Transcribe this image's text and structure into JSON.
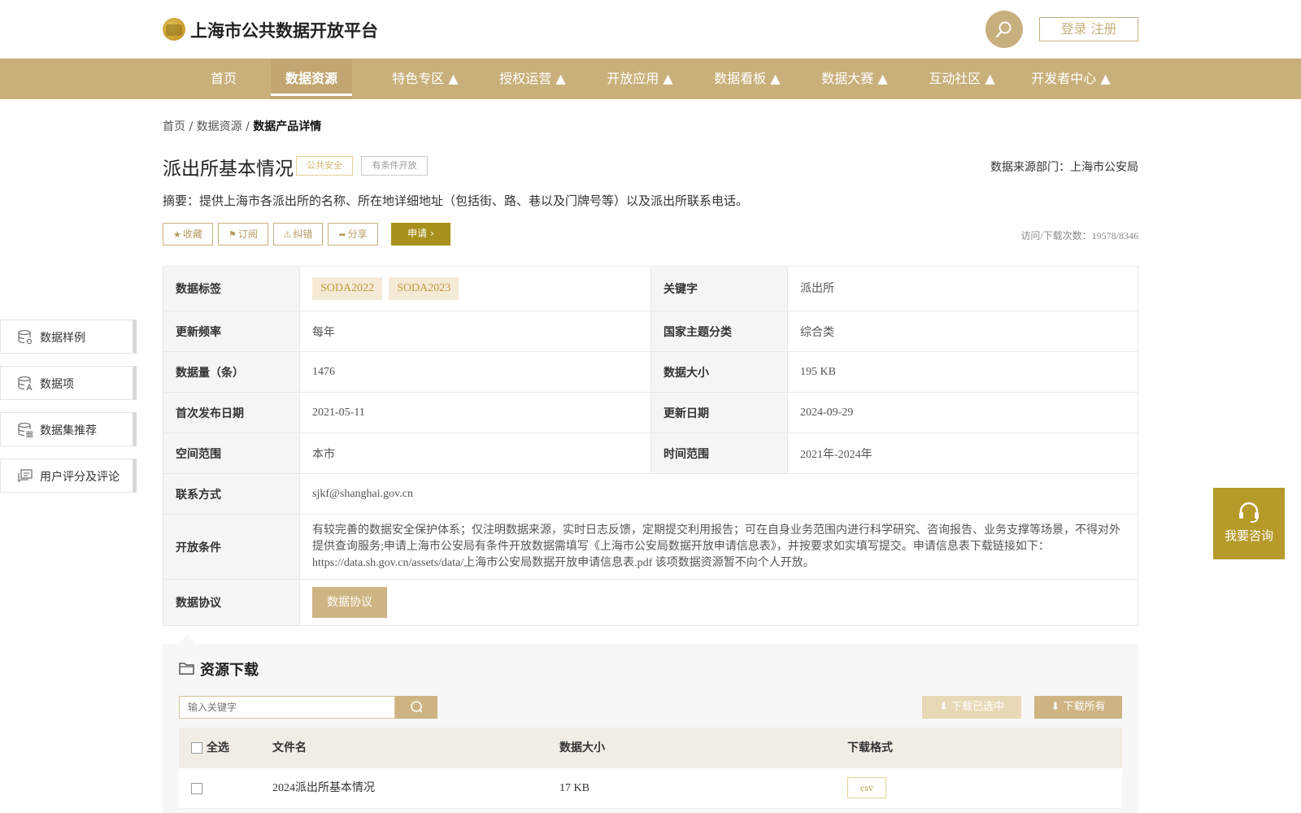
{
  "header": {
    "site_title": "上海市公共数据开放平台",
    "login_label": "登录 注册",
    "icons": {
      "logo": "brand-logo",
      "search": "search-icon"
    }
  },
  "nav": {
    "items": [
      {
        "label": "首页",
        "active": false
      },
      {
        "label": "数据资源",
        "active": true
      },
      {
        "label": "特色专区 ▲",
        "active": false
      },
      {
        "label": "授权运营 ▲",
        "active": false
      },
      {
        "label": "开放应用 ▲",
        "active": false
      },
      {
        "label": "数据看板 ▲",
        "active": false
      },
      {
        "label": "数据大赛 ▲",
        "active": false
      },
      {
        "label": "互动社区 ▲",
        "active": false
      },
      {
        "label": "开发者中心 ▲",
        "active": false
      }
    ]
  },
  "breadcrumb": {
    "home": "首页",
    "sep": "/",
    "section": "数据资源",
    "current": "数据产品详情"
  },
  "product": {
    "title": "派出所基本情况",
    "tag_category": "公共安全",
    "tag_open": "有条件开放",
    "source": "数据来源部门：上海市公安局",
    "summary": "摘要：提供上海市各派出所的名称、所在地详细地址（包括街、路、巷以及门牌号等）以及派出所联系电话。"
  },
  "actions": {
    "favorite": "收藏",
    "subscribe": "订阅",
    "report": "纠错",
    "share": "分享",
    "apply": "申请",
    "visits": "访问/下载次数：19578/8346"
  },
  "info": {
    "tags_label": "数据标签",
    "tags": [
      "SODA2022",
      "SODA2023"
    ],
    "keyword_label": "关键字",
    "keyword": "派出所",
    "freq_label": "更新频率",
    "freq": "每年",
    "theme_label": "国家主题分类",
    "theme": "综合类",
    "count_label": "数据量（条）",
    "count": "1476",
    "size_label": "数据大小",
    "size": "195 KB",
    "first_label": "首次发布日期",
    "first": "2021-05-11",
    "updated_label": "更新日期",
    "updated": "2024-09-29",
    "space_label": "空间范围",
    "space": "本市",
    "time_label": "时间范围",
    "time": "2021年-2024年",
    "contact_label": "联系方式",
    "contact": "sjkf@shanghai.gov.cn",
    "cond_label": "开放条件",
    "cond": "有较完善的数据安全保护体系；仅注明数据来源，实时日志反馈，定期提交利用报告；可在自身业务范围内进行科学研究、咨询报告、业务支撑等场景，不得对外提供查询服务;申请上海市公安局有条件开放数据需填写《上海市公安局数据开放申请信息表》，并按要求如实填写提交。申请信息表下载链接如下：https://data.sh.gov.cn/assets/data/上海市公安局数据开放申请信息表.pdf 该项数据资源暂不向个人开放。",
    "protocol_label": "数据协议",
    "protocol_btn": "数据协议"
  },
  "side_menu": [
    {
      "label": "数据样例",
      "icon": "database-sample-icon"
    },
    {
      "label": "数据项",
      "icon": "database-fields-icon"
    },
    {
      "label": "数据集推荐",
      "icon": "database-recommend-icon"
    },
    {
      "label": "用户评分及评论",
      "icon": "comment-icon"
    }
  ],
  "consult": {
    "label": "我要咨询",
    "icon": "headset-icon"
  },
  "resources": {
    "title": "资源下载",
    "search_placeholder": "输入关键字",
    "download_selected": "下载已选中",
    "download_all": "下载所有",
    "columns": {
      "select_all": "全选",
      "filename": "文件名",
      "size": "数据大小",
      "format": "下载格式"
    },
    "rows": [
      {
        "filename": "2024派出所基本情况",
        "size": "17 KB",
        "format": "csv"
      }
    ]
  },
  "colors": {
    "brand_gold": "#c9b07b",
    "apply_olive": "#a8901c",
    "consult": "#b69a2a"
  }
}
